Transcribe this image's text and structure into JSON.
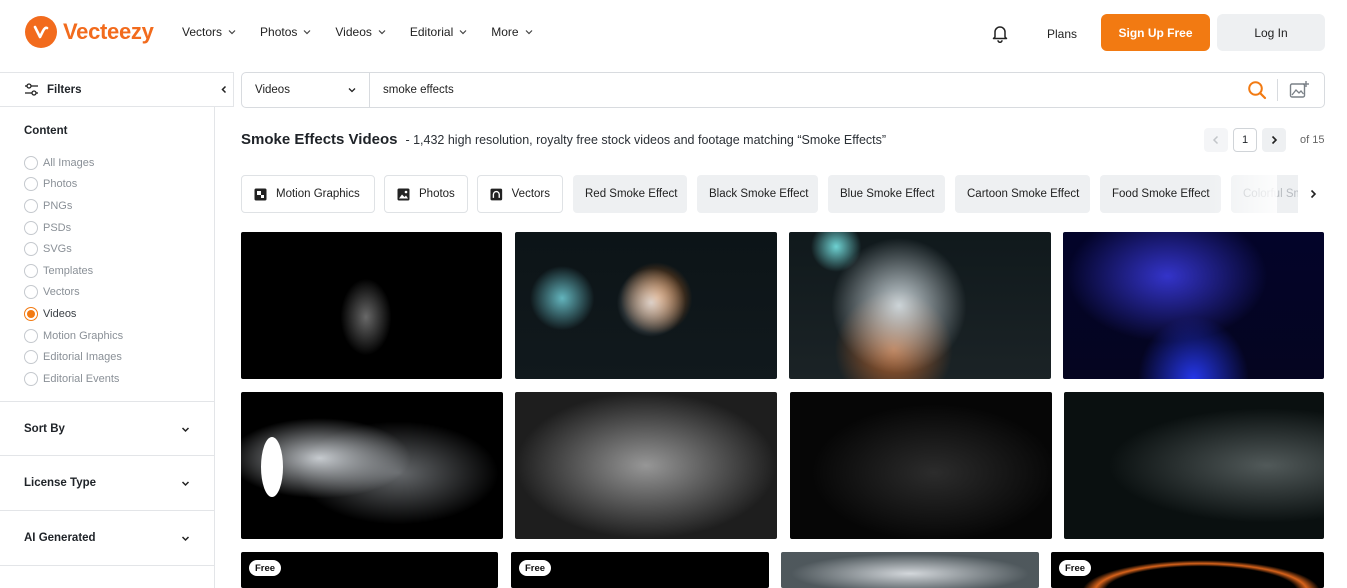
{
  "brand": {
    "name": "Vecteezy",
    "color": "#f26b1d"
  },
  "nav": {
    "items": [
      {
        "label": "Vectors"
      },
      {
        "label": "Photos"
      },
      {
        "label": "Videos"
      },
      {
        "label": "Editorial"
      },
      {
        "label": "More"
      }
    ],
    "plans_label": "Plans",
    "signup_label": "Sign Up Free",
    "login_label": "Log In"
  },
  "sidebar": {
    "filters_label": "Filters",
    "content_title": "Content",
    "content_options": [
      {
        "label": "All Images",
        "selected": false
      },
      {
        "label": "Photos",
        "selected": false
      },
      {
        "label": "PNGs",
        "selected": false
      },
      {
        "label": "PSDs",
        "selected": false
      },
      {
        "label": "SVGs",
        "selected": false
      },
      {
        "label": "Templates",
        "selected": false
      },
      {
        "label": "Vectors",
        "selected": false
      },
      {
        "label": "Videos",
        "selected": true
      },
      {
        "label": "Motion Graphics",
        "selected": false
      },
      {
        "label": "Editorial Images",
        "selected": false
      },
      {
        "label": "Editorial Events",
        "selected": false
      }
    ],
    "sections": [
      {
        "label": "Sort By"
      },
      {
        "label": "License Type"
      },
      {
        "label": "AI Generated"
      }
    ]
  },
  "search": {
    "type_value": "Videos",
    "query": "smoke effects"
  },
  "results": {
    "title": "Smoke Effects Videos",
    "subtitle": "- 1,432 high resolution, royalty free stock videos and footage matching “Smoke Effects”",
    "page": "1",
    "of_pages": "of 15"
  },
  "chips": [
    {
      "label": "Motion Graphics",
      "kind": "type",
      "icon": "motion-graphics-icon"
    },
    {
      "label": "Photos",
      "kind": "type",
      "icon": "photo-icon"
    },
    {
      "label": "Vectors",
      "kind": "type",
      "icon": "vector-icon"
    },
    {
      "label": "Red Smoke Effect",
      "kind": "tag"
    },
    {
      "label": "Black Smoke Effect",
      "kind": "tag"
    },
    {
      "label": "Blue Smoke Effect",
      "kind": "tag"
    },
    {
      "label": "Cartoon Smoke Effect",
      "kind": "tag"
    },
    {
      "label": "Food Smoke Effect",
      "kind": "tag"
    },
    {
      "label": "Colorful Smoke Effect",
      "kind": "tag"
    }
  ],
  "thumbnails": [
    {
      "badge": ""
    },
    {
      "badge": ""
    },
    {
      "badge": ""
    },
    {
      "badge": ""
    },
    {
      "badge": ""
    },
    {
      "badge": ""
    },
    {
      "badge": ""
    },
    {
      "badge": ""
    },
    {
      "badge": "Free"
    },
    {
      "badge": "Free"
    },
    {
      "badge": ""
    },
    {
      "badge": "Free"
    }
  ],
  "colors": {
    "accent": "#f27a12",
    "chip_bg": "#eef0f2",
    "border": "#e3e5e8"
  }
}
